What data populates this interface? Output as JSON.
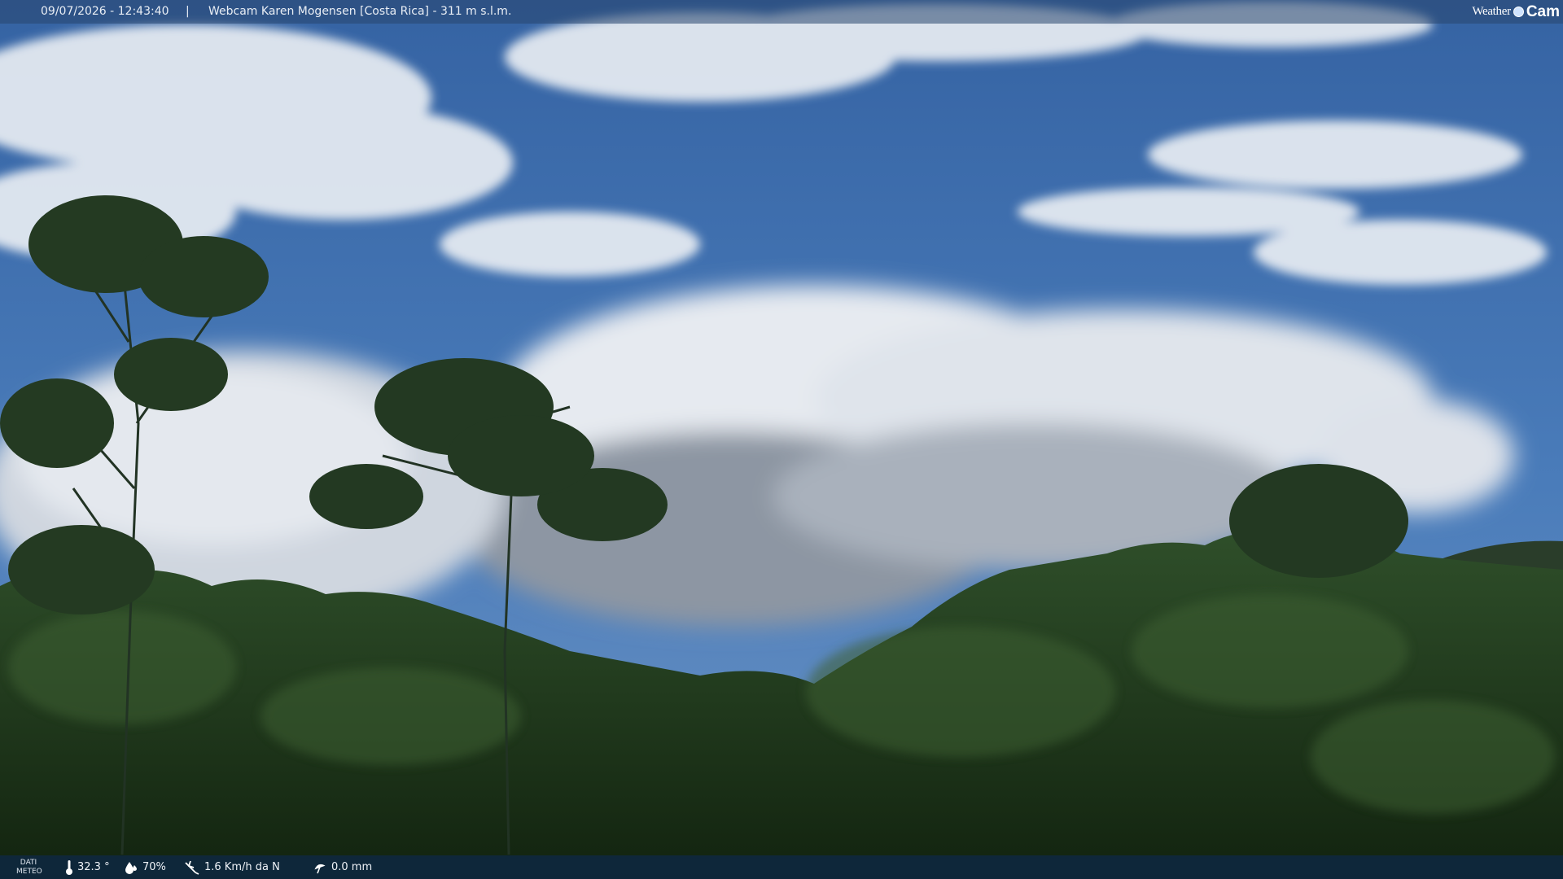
{
  "header": {
    "datetime": "09/07/2026 - 12:43:40",
    "separator": "|",
    "camera": "Webcam Karen Mogensen [Costa Rica] - 311 m s.l.m."
  },
  "logo": {
    "word": "Weather",
    "cam": "Cam"
  },
  "weather": {
    "label_line1": "DATI",
    "label_line2": "METEO",
    "temperature": "32.3 °",
    "humidity": "70%",
    "wind": "1.6 Km/h da N",
    "rain": "0.0 mm"
  },
  "icons": {
    "temperature": "thermometer-icon",
    "humidity": "droplet-icon",
    "wind": "wind-icon",
    "rain": "umbrella-icon"
  },
  "colors": {
    "sky": "#3a6aa8",
    "foliage": "#1f3a1c"
  }
}
